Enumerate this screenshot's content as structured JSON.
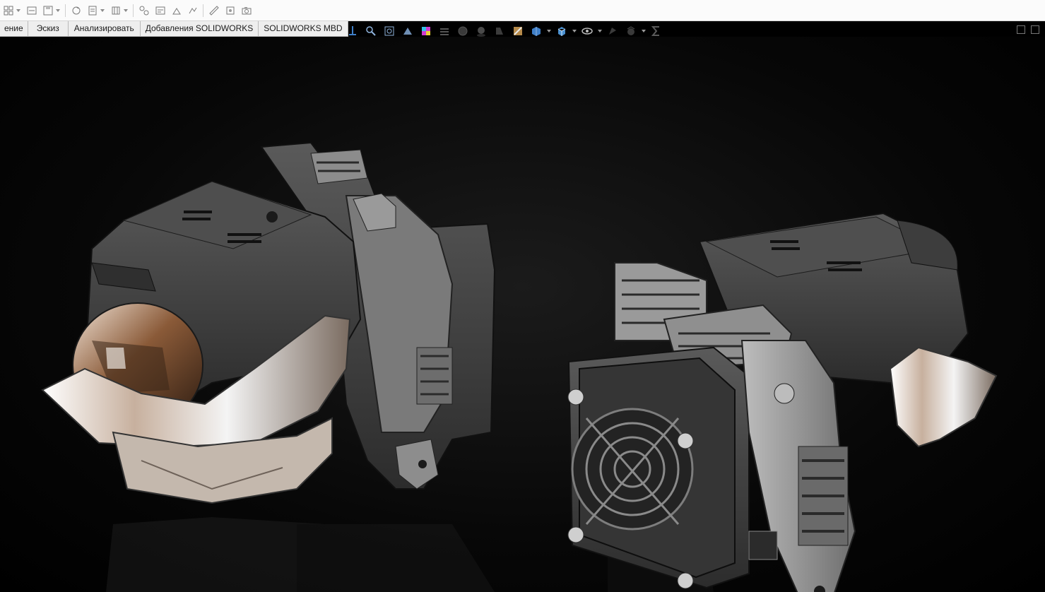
{
  "toolbar": {
    "icons": [
      "new-document-icon",
      "open-icon",
      "save-icon",
      "rebuild-icon",
      "file-properties-icon",
      "options-icon",
      "select-icon",
      "smart-dimension-icon",
      "relations-icon",
      "evaluate-icon",
      "measure-icon",
      "mass-properties-icon",
      "screen-capture-icon"
    ]
  },
  "tabs": [
    "ение",
    "Эскиз",
    "Анализировать",
    "Добавления SOLIDWORKS",
    "SOLIDWORKS MBD"
  ],
  "hud": {
    "icons": [
      "zoom-to-fit-icon",
      "zoom-to-area-icon",
      "previous-view-icon",
      "section-view-icon",
      "view-settings-icon",
      "realview-icon",
      "shadows-icon",
      "ambient-occlusion-icon",
      "perspective-icon",
      "cartoon-icon",
      "display-style-icon",
      "view-orientation-icon",
      "hide-show-icon",
      "appearance-icon",
      "scene-icon",
      "sum-icon"
    ]
  },
  "colors": {
    "accent_check": "#6abf4b",
    "toolbar_bg": "#fbfbfb",
    "viewport_bg": "#000000"
  }
}
